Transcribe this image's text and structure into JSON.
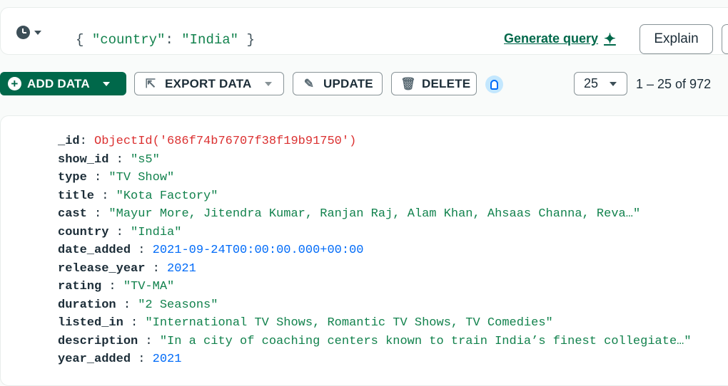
{
  "query_bar": {
    "history_icon": "clock-icon",
    "filter_open": "{ ",
    "filter_key": "\"country\"",
    "filter_colon": ": ",
    "filter_value": "\"India\"",
    "filter_close": " }",
    "generate_label": "Generate query",
    "explain_label": "Explain"
  },
  "toolbar": {
    "add_data": "ADD DATA",
    "export_data": "EXPORT DATA",
    "update": "UPDATE",
    "delete": "DELETE",
    "page_size": "25",
    "range": "1 – 25 of 972"
  },
  "document": {
    "fields": [
      {
        "key": "_id",
        "value": "ObjectId('686f74b76707f38f19b91750')",
        "type": "oid"
      },
      {
        "key": "show_id",
        "value": "\"s5\"",
        "type": "str"
      },
      {
        "key": "type",
        "value": "\"TV Show\"",
        "type": "str"
      },
      {
        "key": "title",
        "value": "\"Kota Factory\"",
        "type": "str"
      },
      {
        "key": "cast",
        "value": "\"Mayur More, Jitendra Kumar, Ranjan Raj, Alam Khan, Ahsaas Channa, Reva…\"",
        "type": "str"
      },
      {
        "key": "country",
        "value": "\"India\"",
        "type": "str"
      },
      {
        "key": "date_added",
        "value": "2021-09-24T00:00:00.000+00:00",
        "type": "num"
      },
      {
        "key": "release_year",
        "value": "2021",
        "type": "num"
      },
      {
        "key": "rating",
        "value": "\"TV-MA\"",
        "type": "str"
      },
      {
        "key": "duration",
        "value": "\"2 Seasons\"",
        "type": "str"
      },
      {
        "key": "listed_in",
        "value": "\"International TV Shows, Romantic TV Shows, TV Comedies\"",
        "type": "str"
      },
      {
        "key": "description",
        "value": "\"In a city of coaching centers known to train India’s finest collegiate…\"",
        "type": "str"
      },
      {
        "key": "year_added",
        "value": "2021",
        "type": "num"
      }
    ]
  },
  "colors": {
    "brand_green": "#00684a",
    "string_value": "#12824d",
    "objectid_value": "#db3030",
    "number_value": "#016bf8"
  }
}
